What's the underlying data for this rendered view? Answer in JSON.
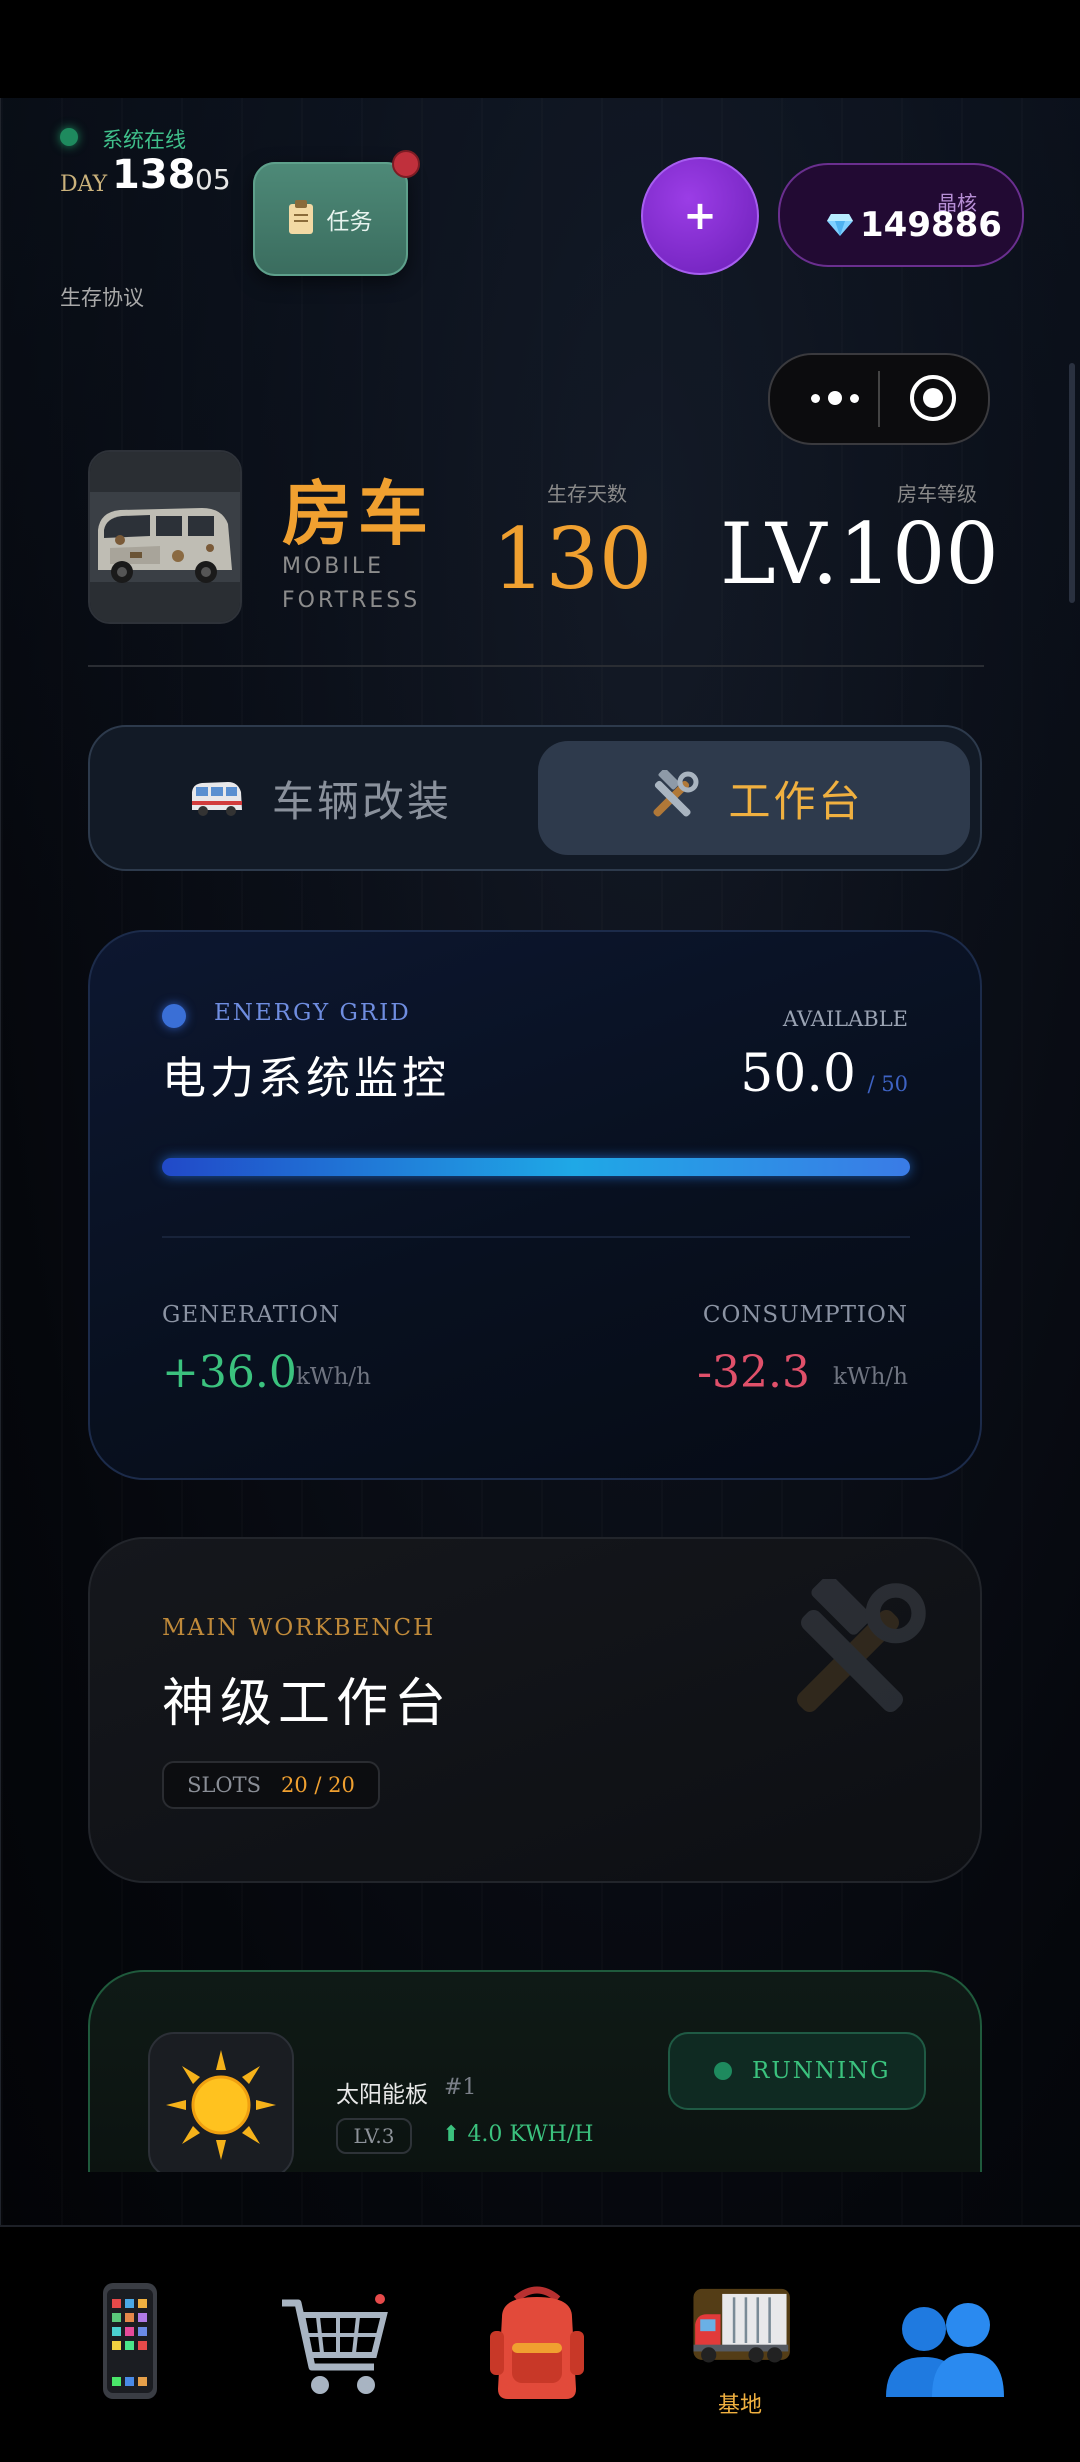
{
  "header": {
    "online_text": "系统在线",
    "day_label": "DAY",
    "day_number": "138",
    "day_sub": "05",
    "protocol_label": "生存协议",
    "task_label": "任务",
    "plus_label": "+",
    "gem_label": "晶核",
    "gem_value": "149886"
  },
  "vehicle": {
    "title": "房车",
    "subtitle": "MOBILE FORTRESS",
    "days_label": "生存天数",
    "days_value": "130",
    "level_label": "房车等级",
    "level_value": "LV.100"
  },
  "tabs": [
    {
      "label": "车辆改装",
      "icon": "van-icon",
      "active": false
    },
    {
      "label": "工作台",
      "icon": "tools-icon",
      "active": true
    }
  ],
  "energy": {
    "tag": "ENERGY GRID",
    "title": "电力系统监控",
    "available_label": "AVAILABLE",
    "available_value": "50.0",
    "available_max": "/ 50",
    "fill_fraction": 1.0,
    "generation_label": "GENERATION",
    "generation_value": "+36.0",
    "generation_unit": "kWh/h",
    "consumption_label": "CONSUMPTION",
    "consumption_value": "-32.3",
    "consumption_unit": "kWh/h"
  },
  "workbench": {
    "tag": "MAIN WORKBENCH",
    "title": "神级工作台",
    "slots_label": "SLOTS",
    "slots_value": "20 / 20"
  },
  "module": {
    "name": "太阳能板",
    "index": "#1",
    "level": "LV.3",
    "rate": "4.0 KWH/H",
    "status": "RUNNING",
    "icon": "sun-icon"
  },
  "bottom_nav": [
    {
      "icon": "phone-icon",
      "label": ""
    },
    {
      "icon": "cart-icon",
      "label": ""
    },
    {
      "icon": "backpack-icon",
      "label": ""
    },
    {
      "icon": "truck-icon",
      "label": "基地",
      "active": true
    },
    {
      "icon": "people-icon",
      "label": ""
    }
  ],
  "colors": {
    "accent_orange": "#f0a030",
    "online_green": "#3bc27e",
    "consumption_red": "#e0506a",
    "energy_blue": "#1fa8e6",
    "gem_purple": "#6c1fb8"
  }
}
